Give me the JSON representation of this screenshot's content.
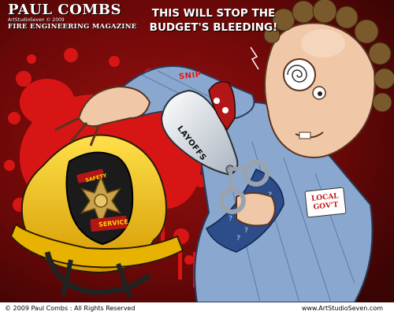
{
  "cartoon": {
    "signature_name": "PAUL COMBS",
    "signature_studio": "ArtStudioSeven © 2009",
    "signature_magazine": "FIRE ENGINEERING MAGAZINE",
    "speech_line1": "THIS WILL STOP THE",
    "speech_line2": "BUDGET'S BLEEDING!",
    "sound_effect": "SNIP",
    "scissors_label": "LAYOFFS",
    "helmet_front_top": "SAFETY",
    "helmet_front_bottom": "SERVICE",
    "badge_line1": "LOCAL",
    "badge_line2": "GOV'T"
  },
  "footer": {
    "copyright": "© 2009 Paul Combs : All Rights Reserved",
    "website": "www.ArtStudioSeven.com"
  },
  "colors": {
    "background": "#7a0a0a",
    "blood": "#d81515",
    "helmet": "#f2c400",
    "shirt": "#8aa8cf",
    "tie": "#2c4c8a",
    "skin": "#f0c7a7",
    "hair": "#7a5a2c"
  }
}
